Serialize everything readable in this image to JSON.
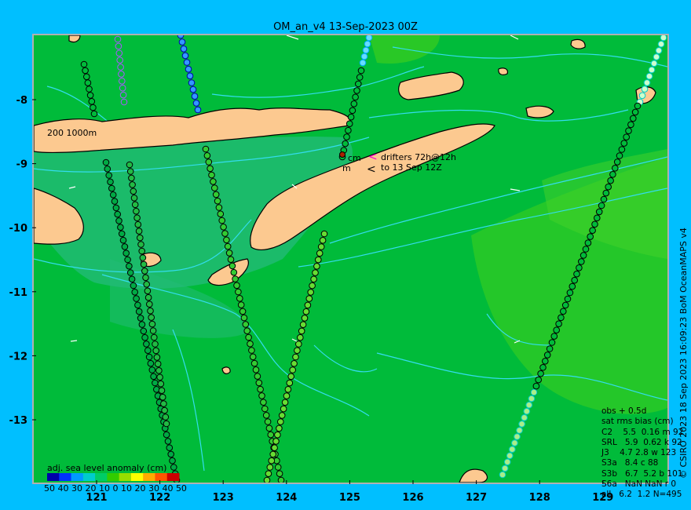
{
  "title": "OM_an_v4  13-Sep-2023 00Z",
  "x_axis": {
    "labels": [
      "121",
      "122",
      "123",
      "124",
      "125",
      "126",
      "127",
      "128",
      "129"
    ]
  },
  "y_axis": {
    "labels": [
      "-8",
      "-9",
      "-10",
      "-11",
      "-12",
      "-13"
    ]
  },
  "depth_label": "200  1000m",
  "drifter_note": {
    "line1": "drifters 72h@12h",
    "line2": "to 13 Sep 12Z",
    "marker1": "<",
    "marker2": "<",
    "cm1": "cm",
    "cm2": "m"
  },
  "credit": "© CSIRO 2023   18 Sep 2023 16:09:23 BoM OceanMAPS v4",
  "stats": {
    "lines": [
      "obs + 0.5d",
      "sat rms bias (cm)",
      "C2    5.5  0.16 m 92",
      "SRL   5.9  0.62 k 92",
      "J3    4.7 2.8 w 123",
      "S3a   8.4 c 88",
      "S3b   6.7  5.2 b 101",
      "S6a   NaN NaN r 0",
      "all   6.2  1.2 N=495"
    ]
  },
  "legend": {
    "title": "adj. sea level anomaly (cm)",
    "ticks": "50 40 30 20 10  0   10 20 30 40 50",
    "colors": [
      "#0000aa",
      "#0033ff",
      "#0099ff",
      "#00cccc",
      "#00cc66",
      "#33cc00",
      "#99dd00",
      "#ffff00",
      "#ffaa00",
      "#ff5500",
      "#cc0000"
    ]
  },
  "colors": {
    "sea": "#00bb3a",
    "sea_deep": "#22bb77",
    "sea_light": "#33cc22",
    "land": "#fcc990",
    "contour": "#33ddee",
    "frame": "#b0b0b0",
    "background": "#00bfff"
  }
}
